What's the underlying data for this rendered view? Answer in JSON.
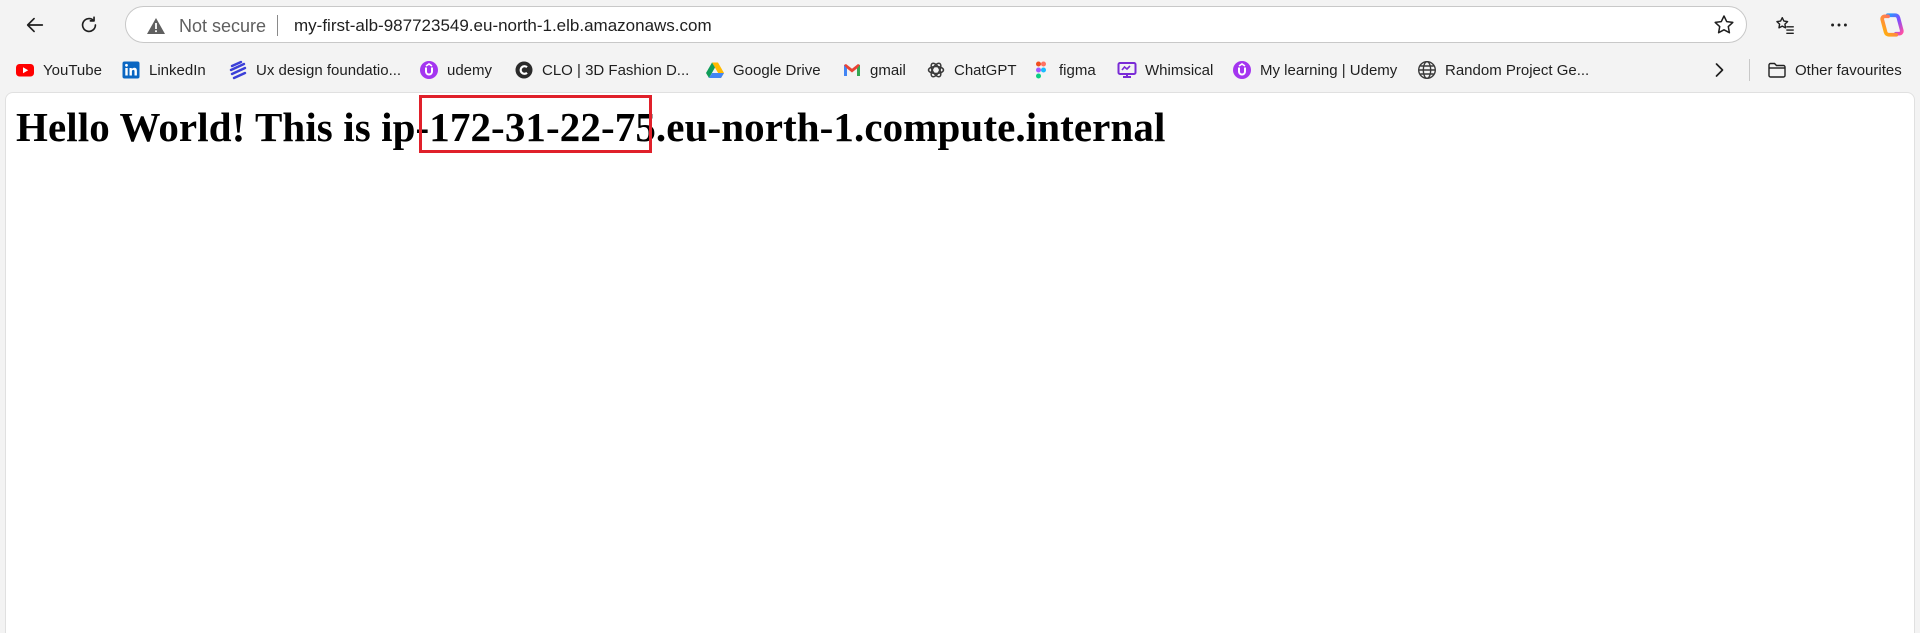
{
  "toolbar": {
    "security_text": "Not secure",
    "url": "my-first-alb-987723549.eu-north-1.elb.amazonaws.com"
  },
  "bookmarks": {
    "items": [
      {
        "label": "YouTube",
        "icon": "youtube-icon"
      },
      {
        "label": "LinkedIn",
        "icon": "linkedin-icon"
      },
      {
        "label": "Ux design foundatio...",
        "icon": "ux-design-icon"
      },
      {
        "label": "udemy",
        "icon": "udemy-icon"
      },
      {
        "label": "CLO | 3D Fashion D...",
        "icon": "clo-icon"
      },
      {
        "label": "Google Drive",
        "icon": "google-drive-icon"
      },
      {
        "label": "gmail",
        "icon": "gmail-icon"
      },
      {
        "label": "ChatGPT",
        "icon": "chatgpt-icon"
      },
      {
        "label": "figma",
        "icon": "figma-icon"
      },
      {
        "label": "Whimsical",
        "icon": "whimsical-icon"
      },
      {
        "label": "My learning | Udemy",
        "icon": "udemy-icon"
      },
      {
        "label": "Random Project Ge...",
        "icon": "globe-icon"
      }
    ],
    "other": "Other favourites"
  },
  "page": {
    "heading": "Hello World! This is ip-172-31-22-75.eu-north-1.compute.internal"
  },
  "colors": {
    "highlight": "#e0202a",
    "udemy": "#a435f0",
    "youtube": "#ff0000",
    "linkedin": "#0a66c2"
  }
}
